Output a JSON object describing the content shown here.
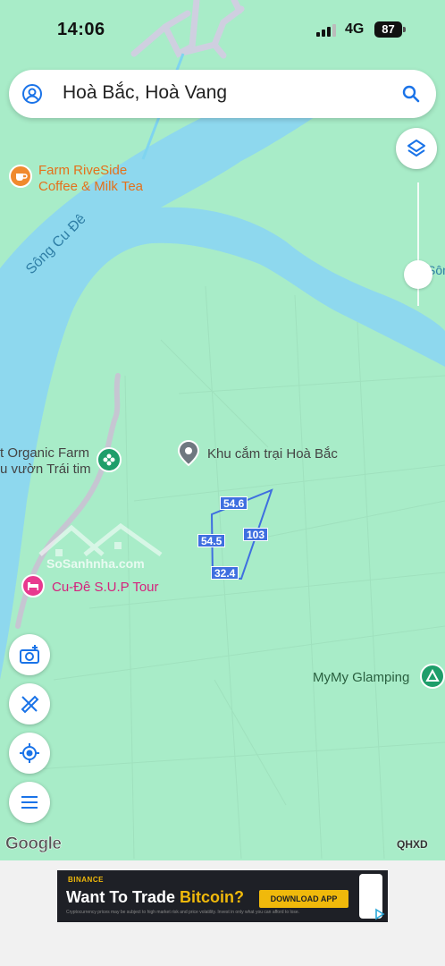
{
  "status_bar": {
    "time": "14:06",
    "network": "4G",
    "battery": "87"
  },
  "search": {
    "query": "Hoà Bắc, Hoà Vang"
  },
  "map": {
    "colors": {
      "land": "#a8ecc8",
      "water": "#8ed8ee",
      "road": "#ffffff",
      "measure": "#3f6fe0"
    },
    "river_labels": [
      "Sông Cu Đê",
      "Sôn"
    ],
    "pois": {
      "farm_riverside": [
        "Farm RiveSide",
        "Coffee & Milk Tea"
      ],
      "organic_farm": [
        "t Organic Farm",
        "u vườn Trái tim"
      ],
      "camp": "Khu cắm trại Hoà Bắc",
      "sup_tour": "Cu-Đê S.U.P Tour",
      "glamping": "MyMy Glamping"
    },
    "measurements": [
      "54.6",
      "54.5",
      "103",
      "32.4"
    ],
    "watermark": "SoSanhnha.com",
    "attribution": "Google",
    "provider": "QHXD"
  },
  "ad": {
    "brand": "BINANCE",
    "headline_start": "Want To Trade ",
    "headline_accent": "Bitcoin?",
    "cta": "DOWNLOAD APP",
    "fine_print": "Cryptocurrency prices may be subject to high market risk and price volatility. Invest in only what you can afford to lose."
  }
}
